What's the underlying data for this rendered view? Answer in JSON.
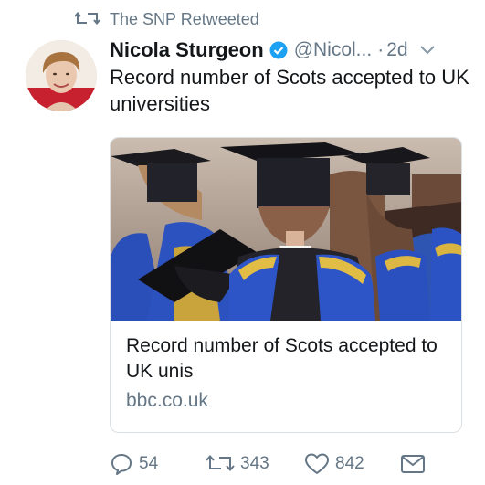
{
  "retweet_context": {
    "icon": "retweet-icon",
    "text": "The SNP Retweeted"
  },
  "tweet": {
    "author_name": "Nicola Sturgeon",
    "handle": "@Nicol...",
    "separator": "·",
    "time": "2d",
    "text": "Record number of Scots accepted to UK universities",
    "verified_color": "#1da1f2"
  },
  "card": {
    "title": "Record number of Scots accepted to UK unis",
    "domain": "bbc.co.uk"
  },
  "actions": {
    "reply_count": "54",
    "retweet_count": "343",
    "like_count": "842"
  },
  "colors": {
    "text": "#14171a",
    "muted": "#657786",
    "accent": "#1da1f2"
  }
}
